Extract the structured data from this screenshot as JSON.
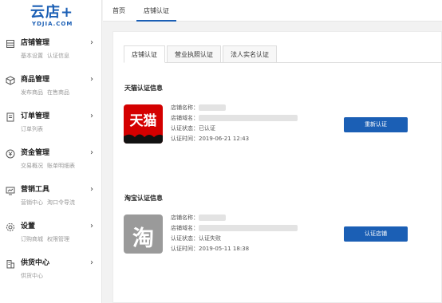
{
  "logo": {
    "main": "云店+",
    "sub": "YDJIA.COM"
  },
  "sidebar": {
    "groups": [
      {
        "title": "店铺管理",
        "subs": [
          "基本设置",
          "认证信息"
        ]
      },
      {
        "title": "商品管理",
        "subs": [
          "发布商品",
          "在售商品"
        ]
      },
      {
        "title": "订单管理",
        "subs": [
          "订单列表"
        ]
      },
      {
        "title": "资金管理",
        "subs": [
          "交易概况",
          "账单明细表"
        ]
      },
      {
        "title": "营销工具",
        "subs": [
          "营销中心",
          "淘口令导流"
        ]
      },
      {
        "title": "设置",
        "subs": [
          "订购商城",
          "权限管理"
        ]
      },
      {
        "title": "供货中心",
        "subs": [
          "供货中心"
        ]
      }
    ],
    "arrow": "›"
  },
  "topbar": {
    "tabs": [
      "首页",
      "店铺认证"
    ]
  },
  "content": {
    "tabs": [
      "店铺认证",
      "营业执照认证",
      "法人实名认证"
    ],
    "tmall": {
      "section_title": "天猫认证信息",
      "logo_text": "天猫",
      "name_label": "店铺名称：",
      "domain_label": "店铺域名：",
      "status": "认证状态：已认证",
      "time": "认证时间：2019-06-21 12:43",
      "button": "重新认证"
    },
    "taobao": {
      "section_title": "淘宝认证信息",
      "logo_text": "淘",
      "name_label": "店铺名称：",
      "domain_label": "店铺域名：",
      "status": "认证状态：认证失败",
      "time": "认证时间：2019-05-11 18:38",
      "button": "认证店铺"
    }
  }
}
